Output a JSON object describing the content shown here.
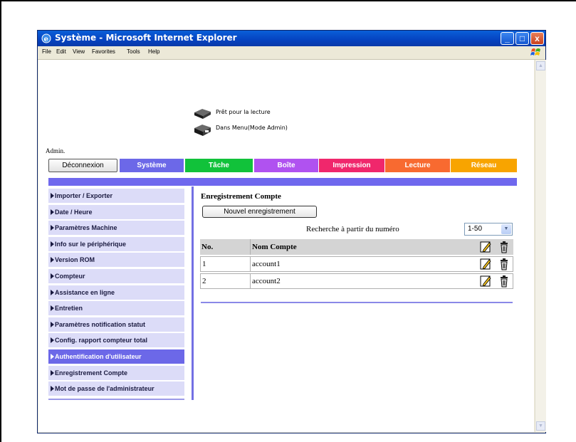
{
  "window": {
    "title": "Système - Microsoft Internet Explorer",
    "minimize_glyph": "_",
    "maximize_glyph": "□",
    "close_glyph": "x"
  },
  "menubar": {
    "items": [
      "File",
      "Edit",
      "View",
      "Favorites",
      "Tools",
      "Help"
    ]
  },
  "status": {
    "line1": "Prêt pour la lecture",
    "line2": "Dans Menu(Mode Admin)"
  },
  "user": {
    "label": "Admin."
  },
  "nav": {
    "logout_label": "Déconnexion",
    "tabs": [
      {
        "label": "Système",
        "color": "#6c68e8"
      },
      {
        "label": "Tâche",
        "color": "#11c23a"
      },
      {
        "label": "Boîte",
        "color": "#b052f0"
      },
      {
        "label": "Impression",
        "color": "#f0276c"
      },
      {
        "label": "Lecture",
        "color": "#f86a30"
      },
      {
        "label": "Réseau",
        "color": "#f8a400"
      }
    ]
  },
  "sidebar": {
    "active_index": 10,
    "items": [
      "Importer / Exporter",
      "Date / Heure",
      "Paramètres Machine",
      "Info sur le périphérique",
      "Version ROM",
      "Compteur",
      "Assistance en ligne",
      "Entretien",
      "Paramètres notification statut",
      "Config. rapport compteur total",
      "Authentification d'utilisateur",
      "Enregistrement Compte",
      "Mot de passe de l'administrateur"
    ]
  },
  "main": {
    "title": "Enregistrement Compte",
    "new_button_label": "Nouvel enregistrement",
    "search_label": "Recherche à partir du numéro",
    "range_value": "1-50",
    "table": {
      "headers": [
        "No.",
        "Nom Compte"
      ],
      "rows": [
        {
          "no": "1",
          "name": "account1"
        },
        {
          "no": "2",
          "name": "account2"
        }
      ]
    }
  },
  "colors": {
    "accent_band": "#6f68ee",
    "sidebar_bg": "#dcdcf8",
    "sidebar_active": "#6c68e8"
  }
}
